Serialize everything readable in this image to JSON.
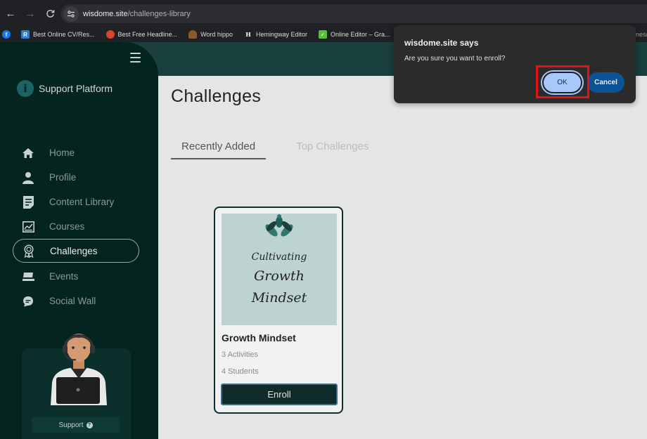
{
  "browser": {
    "url_host": "wisdome.site",
    "url_path": "/challenges-library",
    "bookmarks": [
      {
        "label": "",
        "icon": "facebook-icon",
        "color": "#1877f2"
      },
      {
        "label": "Best Online CV/Res...",
        "icon": "r-icon",
        "color": "#2e7fd1"
      },
      {
        "label": "Best Free Headline...",
        "icon": "ball-icon",
        "color": "#d9442b"
      },
      {
        "label": "Word hippo",
        "icon": "hippo-icon",
        "color": "#8a5a2b"
      },
      {
        "label": "Hemingway Editor",
        "icon": "h-icon",
        "color": "#202124"
      },
      {
        "label": "Online Editor – Gra...",
        "icon": "check-icon",
        "color": "#5bbd3a"
      }
    ],
    "edge_text": "nesa"
  },
  "sidebar": {
    "brand": "Support Platform",
    "items": [
      {
        "label": "Home",
        "icon": "home-icon",
        "active": false
      },
      {
        "label": "Profile",
        "icon": "profile-icon",
        "active": false
      },
      {
        "label": "Content Library",
        "icon": "content-library-icon",
        "active": false
      },
      {
        "label": "Courses",
        "icon": "courses-icon",
        "active": false
      },
      {
        "label": "Challenges",
        "icon": "challenges-icon",
        "active": true
      },
      {
        "label": "Events",
        "icon": "events-icon",
        "active": false
      },
      {
        "label": "Social Wall",
        "icon": "social-wall-icon",
        "active": false
      }
    ],
    "support_label": "Support"
  },
  "main": {
    "title": "Challenges",
    "tabs": [
      {
        "label": "Recently Added",
        "active": true
      },
      {
        "label": "Top Challenges",
        "active": false
      }
    ],
    "card": {
      "image_text": [
        "Cultivating",
        "Growth",
        "Mindset"
      ],
      "title": "Growth Mindset",
      "activities": "3 Activities",
      "students": "4 Students",
      "enroll_label": "Enroll"
    }
  },
  "dialog": {
    "title": "wisdome.site says",
    "message": "Are you sure you want to enroll?",
    "ok_label": "OK",
    "cancel_label": "Cancel"
  },
  "colors": {
    "sidebar_bg": "#042420",
    "header_bg": "#19403e",
    "ok_button": "#a8c7fa",
    "cancel_button": "#0b5394",
    "highlight_box": "#e3131b"
  }
}
